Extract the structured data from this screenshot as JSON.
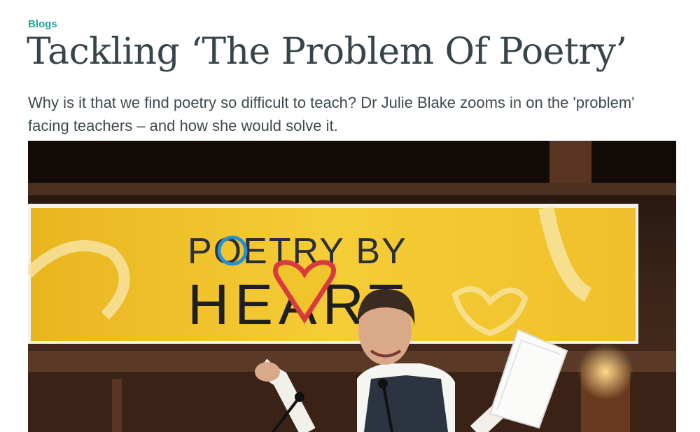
{
  "article": {
    "category": "Blogs",
    "title": "Tackling ‘The Problem Of Poetry’",
    "standfirst": "Why is it that we find poetry so difficult to teach? Dr Julie Blake zooms in on the 'problem' facing teachers – and how she would solve it."
  },
  "hero_image": {
    "banner_line1": "POETRY BY",
    "banner_line2": "HEART",
    "colors": {
      "banner": "#f2c52a",
      "heart": "#d93a3f",
      "accent_blue": "#2a8fd0",
      "text_dark": "#222222"
    }
  },
  "colors": {
    "category": "#1fa79a",
    "title": "#37454b",
    "body": "#3e4a50"
  }
}
